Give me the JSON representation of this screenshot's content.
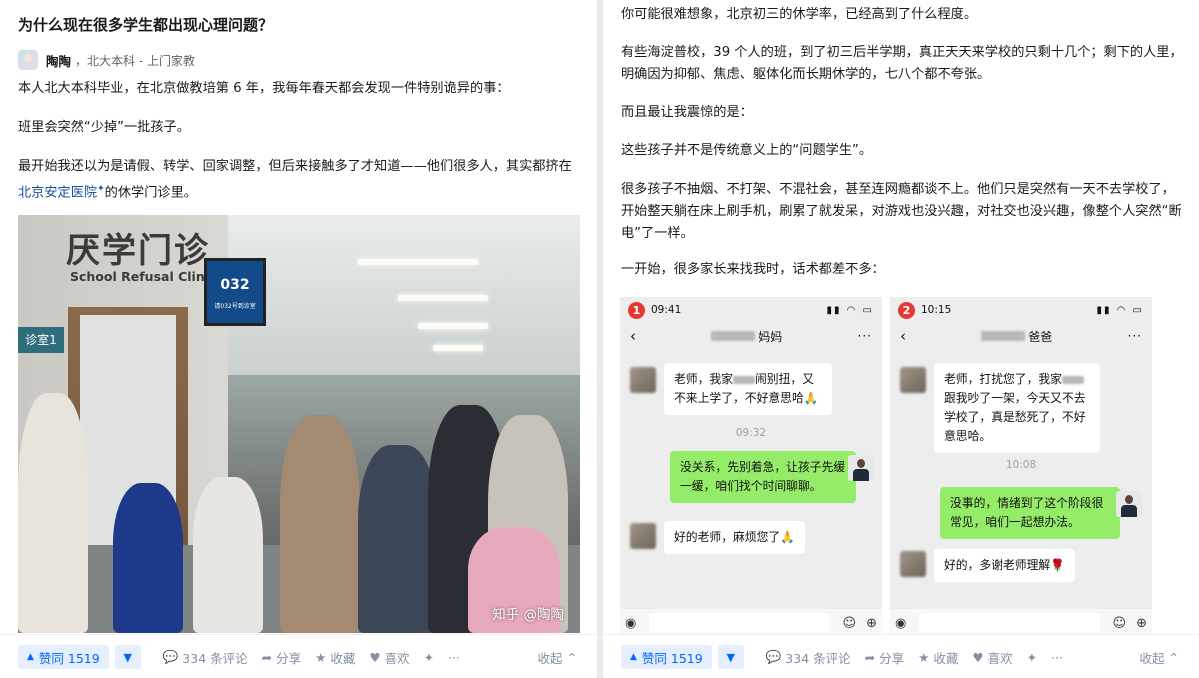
{
  "left": {
    "question_title": "为什么现在很多学生都出现心理问题？",
    "author_name": "陶陶",
    "author_meta": "北大本科 - 上门家教",
    "paragraphs": [
      "本人北大本科毕业，在北京做教培第 6 年，我每年春天都会发现一件特别诡异的事：",
      "班里会突然“少掉”一批孩子。"
    ],
    "p3_before": "最开始我还以为是请假、转学、回家调整，但后来接触多了才知道——他们很多人，其实都挤在",
    "p3_link": "北京安定医院",
    "p3_after": "的休学门诊里。",
    "photo": {
      "sign_cn": "厌学门诊",
      "sign_en": "School Refusal Clinic",
      "screen_label": "请032号到诊室",
      "screen_number": "032",
      "room_sign": "诊室1",
      "watermark": "知乎 @陶陶"
    },
    "actions": {
      "vote": "赞同 1519",
      "comments": "334 条评论",
      "share": "分享",
      "favorite": "收藏",
      "like": "喜欢",
      "collapse": "收起"
    }
  },
  "right": {
    "paragraphs": [
      "你可能很难想象，北京初三的休学率，已经高到了什么程度。",
      "有些海淀普校，39 个人的班，到了初三后半学期，真正天天来学校的只剩十几个；剩下的人里，明确因为抑郁、焦虑、躯体化而长期休学的，七八个都不夸张。",
      "而且最让我震惊的是：",
      "这些孩子并不是传统意义上的“问题学生”。",
      "很多孩子不抽烟、不打架、不混社会，甚至连网瘾都谈不上。他们只是突然有一天不去学校了，开始整天躺在床上刷手机，刷累了就发呆，对游戏也没兴趣，对社交也没兴趣，像整个人突然“断电”了一样。",
      "一开始，很多家长来找我时，话术都差不多："
    ],
    "chat1": {
      "badge": "1",
      "time": "09:41",
      "title": "妈妈",
      "msg1_a": "老师，我家",
      "msg1_b": "闹别扭，又不来上学了，不好意思哈🙏",
      "timestamp": "09:32",
      "msg2": "没关系，先别着急，让孩子先缓一缓，咱们找个时间聊聊。",
      "msg3": "好的老师，麻烦您了🙏"
    },
    "chat2": {
      "badge": "2",
      "time": "10:15",
      "title": "爸爸",
      "msg1_a": "老师，打扰您了，我家",
      "msg1_b": "跟我吵了一架，今天又不去学校了，真是愁死了，不好意思哈。",
      "timestamp": "10:08",
      "msg2": "没事的，情绪到了这个阶段很常见，咱们一起想办法。",
      "msg3": "好的，多谢老师理解🌹"
    },
    "actions": {
      "vote": "赞同 1519",
      "comments": "334 条评论",
      "share": "分享",
      "favorite": "收藏",
      "like": "喜欢",
      "collapse": "收起"
    }
  },
  "icons": [
    "vote-up-icon",
    "vote-down-icon",
    "comment-icon",
    "share-icon",
    "star-icon",
    "heart-icon",
    "sparkle-icon",
    "more-icon",
    "chevron-up-icon"
  ],
  "colors": {
    "accent": "#0066ff",
    "link": "#175199",
    "wechat_green": "#95ec69",
    "badge_red": "#e53935"
  }
}
